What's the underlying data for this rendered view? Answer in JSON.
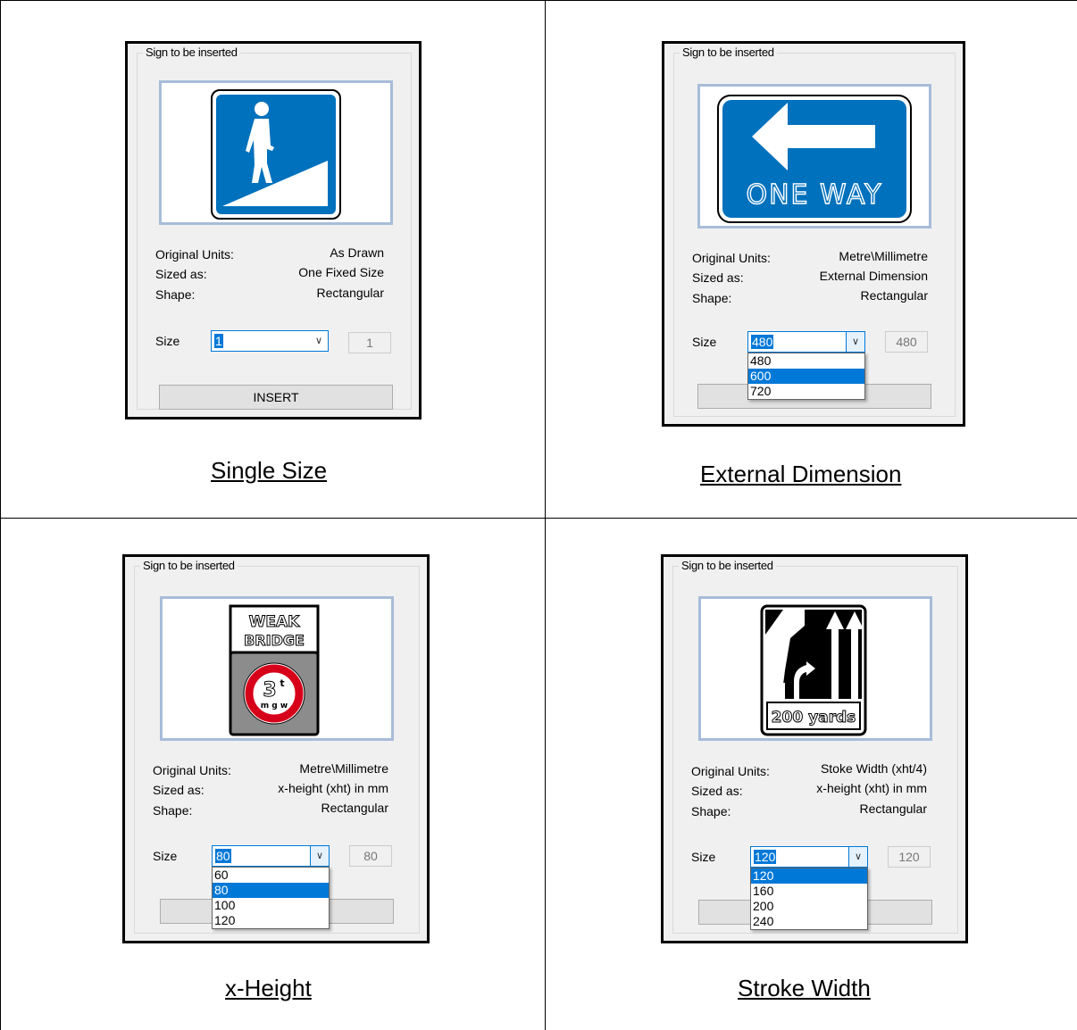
{
  "panels": [
    {
      "group_title": "Sign to be inserted",
      "labels": [
        "Original Units:",
        "Sized as:",
        "Shape:"
      ],
      "values": [
        "As Drawn",
        "One Fixed Size",
        "Rectangular"
      ],
      "size_label": "Size",
      "size_value": "1",
      "size_readout": "1",
      "insert_label": "INSERT",
      "dropdown_open": false,
      "options": [],
      "caption": "Single Size"
    },
    {
      "group_title": "Sign to be inserted",
      "labels": [
        "Original Units:",
        "Sized as:",
        "Shape:"
      ],
      "values": [
        "Metre\\Millimetre",
        "External Dimension",
        "Rectangular"
      ],
      "size_label": "Size",
      "size_value": "480",
      "size_readout": "480",
      "insert_label": "",
      "dropdown_open": true,
      "options": [
        "480",
        "600",
        "720"
      ],
      "selected_option": "600",
      "caption": "External Dimension",
      "sign_text": "ONE WAY"
    },
    {
      "group_title": "Sign to be inserted",
      "labels": [
        "Original Units:",
        "Sized as:",
        "Shape:"
      ],
      "values": [
        "Metre\\Millimetre",
        "x-height (xht) in mm",
        "Rectangular"
      ],
      "size_label": "Size",
      "size_value": "80",
      "size_readout": "80",
      "insert_label": "",
      "dropdown_open": true,
      "options": [
        "60",
        "80",
        "100",
        "120"
      ],
      "selected_option": "80",
      "caption": "x-Height",
      "sign_text": [
        "WEAK",
        "BRIDGE",
        "3",
        "t",
        "m g w"
      ]
    },
    {
      "group_title": "Sign to be inserted",
      "labels": [
        "Original Units:",
        "Sized as:",
        "Shape:"
      ],
      "values": [
        "Stoke Width (xht/4)",
        "x-height (xht) in mm",
        "Rectangular"
      ],
      "size_label": "Size",
      "size_value": "120",
      "size_readout": "120",
      "insert_label": "",
      "dropdown_open": true,
      "options": [
        "120",
        "160",
        "200",
        "240"
      ],
      "selected_option": "120",
      "caption": "Stroke Width",
      "sign_text": "200 yards"
    }
  ],
  "colors": {
    "sign_blue": "#0071bc",
    "select_blue": "#0078d7",
    "preview_border": "#a8bcd9",
    "red_ring": "#d7001a",
    "grey_panel": "#8c8c8c"
  },
  "icons": [
    "pedestrian-ramp-sign-icon",
    "one-way-arrow-sign-icon",
    "weak-bridge-sign-icon",
    "lane-merge-sign-icon",
    "chevron-down-icon"
  ]
}
